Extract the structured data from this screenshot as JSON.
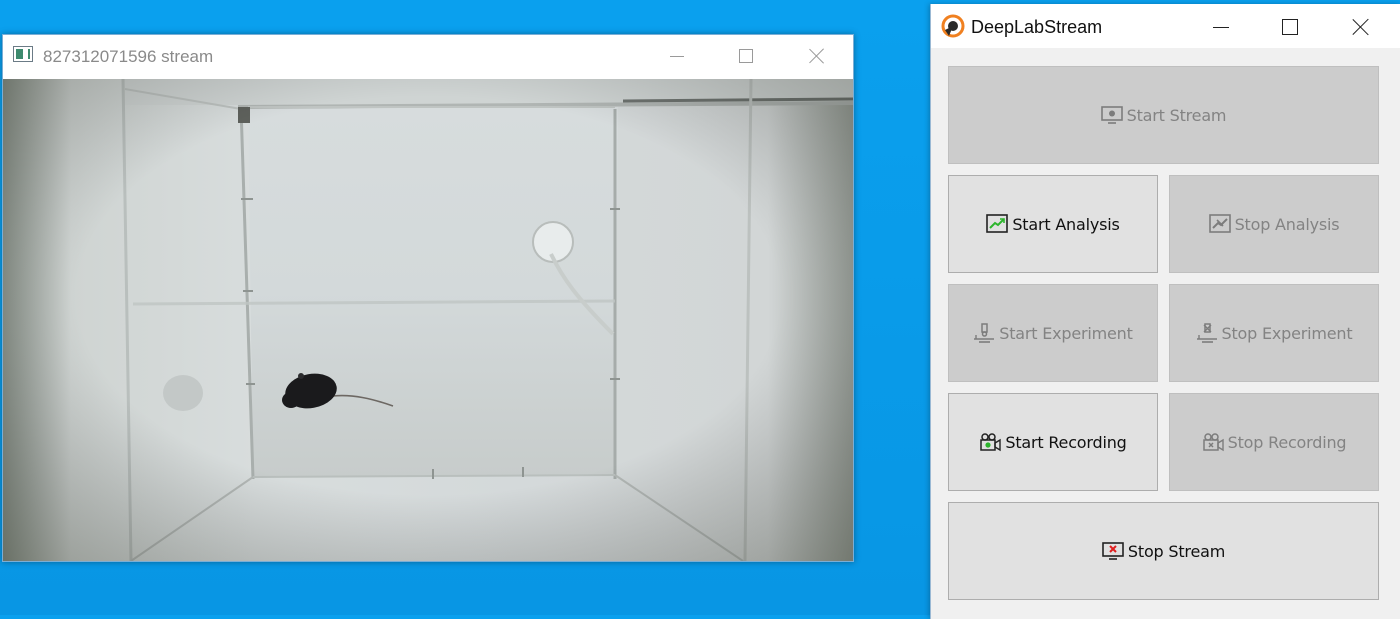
{
  "stream_window": {
    "title": "827312071596 stream",
    "controls": [
      "minimize",
      "maximize",
      "close"
    ]
  },
  "panel_window": {
    "title": "DeepLabStream",
    "controls": [
      "minimize",
      "maximize",
      "close"
    ],
    "buttons": {
      "start_stream": {
        "label": "Start Stream",
        "enabled": false,
        "icon": "monitor-icon"
      },
      "start_analysis": {
        "label": "Start Analysis",
        "enabled": true,
        "icon": "chart-icon"
      },
      "stop_analysis": {
        "label": "Stop Analysis",
        "enabled": false,
        "icon": "chart-icon"
      },
      "start_experiment": {
        "label": "Start Experiment",
        "enabled": false,
        "icon": "microscope-icon"
      },
      "stop_experiment": {
        "label": "Stop Experiment",
        "enabled": false,
        "icon": "microscope-icon"
      },
      "start_recording": {
        "label": "Start Recording",
        "enabled": true,
        "icon": "camera-icon"
      },
      "stop_recording": {
        "label": "Stop Recording",
        "enabled": false,
        "icon": "camera-icon"
      },
      "stop_stream": {
        "label": "Stop Stream",
        "enabled": true,
        "icon": "monitor-stop-icon"
      }
    }
  },
  "colors": {
    "desktop": "#0a9ae8",
    "button_enabled": "#e1e1e1",
    "button_disabled": "#cccccc",
    "accent_green": "#2db52d",
    "stop_red": "#e02020"
  }
}
